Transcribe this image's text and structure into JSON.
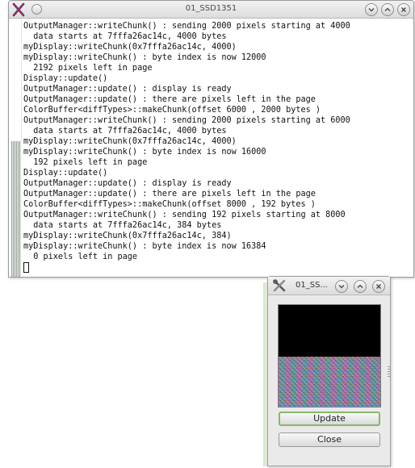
{
  "main_window": {
    "title": "01_SSD1351",
    "lines": [
      "OutputManager::writeChunk() : sending 2000 pixels starting at 4000",
      "  data starts at 7fffa26ac14c, 4000 bytes",
      "myDisplay::writeChunk(0x7fffa26ac14c, 4000)",
      "myDisplay::writeChunk() : byte index is now 12000",
      "  2192 pixels left in page",
      "Display::update()",
      "OutputManager::update() : display is ready",
      "OutputManager::update() : there are pixels left in the page",
      "ColorBuffer<diffTypes>::makeChunk(offset 6000 , 2000 bytes )",
      "OutputManager::writeChunk() : sending 2000 pixels starting at 6000",
      "  data starts at 7fffa26ac14c, 4000 bytes",
      "myDisplay::writeChunk(0x7fffa26ac14c, 4000)",
      "myDisplay::writeChunk() : byte index is now 16000",
      "  192 pixels left in page",
      "Display::update()",
      "OutputManager::update() : display is ready",
      "OutputManager::update() : there are pixels left in the page",
      "ColorBuffer<diffTypes>::makeChunk(offset 8000 , 192 bytes )",
      "OutputManager::writeChunk() : sending 192 pixels starting at 8000",
      "  data starts at 7fffa26ac14c, 384 bytes",
      "myDisplay::writeChunk(0x7fffa26ac14c, 384)",
      "myDisplay::writeChunk() : byte index is now 16384",
      "  0 pixels left in page"
    ],
    "icons": {
      "app": "x-app-icon",
      "menu": "circle-menu-icon",
      "minimize": "chevron-down-icon",
      "maximize": "chevron-up-icon",
      "close": "close-icon"
    }
  },
  "small_window": {
    "title": "01_SS...",
    "update_label": "Update",
    "close_label": "Close"
  },
  "colors": {
    "app_icon_red": "#d2232a",
    "app_icon_blue": "#2b3f93",
    "focus_green": "#86b86a"
  }
}
